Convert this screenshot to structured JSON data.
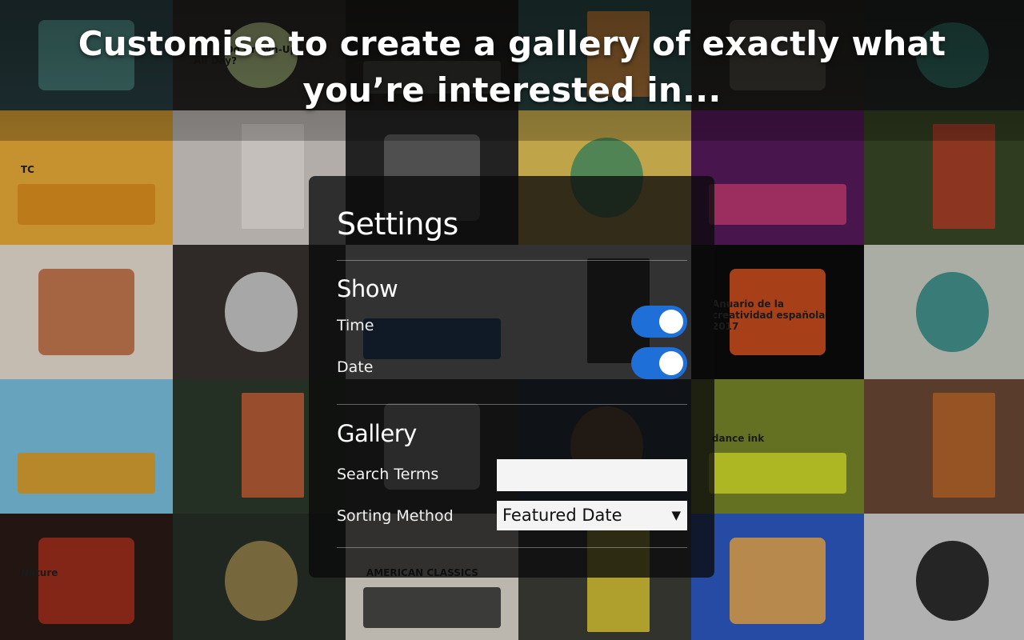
{
  "headline": {
    "line1": "Customise to create a gallery of exactly what",
    "line2": "you’re interested in..."
  },
  "gallery": {
    "tiles": [
      {
        "bg": "#2f4a4d",
        "accent": "#5fa9a2",
        "caption": ""
      },
      {
        "bg": "#2c2a26",
        "accent": "#b8c98a",
        "caption": "What Do Grown-Ups Do All Day?"
      },
      {
        "bg": "#1e1d1b",
        "accent": "#3a3935",
        "caption": ""
      },
      {
        "bg": "#2c4c4a",
        "accent": "#d98a3b",
        "caption": ""
      },
      {
        "bg": "#23221f",
        "accent": "#4a4540",
        "caption": ""
      },
      {
        "bg": "#1f2322",
        "accent": "#2f6d62",
        "caption": ""
      },
      {
        "bg": "#f1b23a",
        "accent": "#e58f1f",
        "caption": "TC"
      },
      {
        "bg": "#d9d4cf",
        "accent": "#f2ede8",
        "caption": ""
      },
      {
        "bg": "#2a2a2a",
        "accent": "#6b6b6b",
        "caption": ""
      },
      {
        "bg": "#e9c85a",
        "accent": "#4b9a6a",
        "caption": ""
      },
      {
        "bg": "#5a1a5e",
        "accent": "#d13f78",
        "caption": ""
      },
      {
        "bg": "#3b4a26",
        "accent": "#c0402a",
        "caption": ""
      },
      {
        "bg": "#efe5d8",
        "accent": "#c46a3a",
        "caption": ""
      },
      {
        "bg": "#3a3330",
        "accent": "#e8e8e8",
        "caption": ""
      },
      {
        "bg": "#e7e7e7",
        "accent": "#0b4f9e",
        "caption": ""
      },
      {
        "bg": "#ece8e3",
        "accent": "#1b1b1b",
        "caption": ""
      },
      {
        "bg": "#0c0c0c",
        "accent": "#ee5a22",
        "caption": "Anuario de la creatividad española 2017"
      },
      {
        "bg": "#cfd3c9",
        "accent": "#2e8c88",
        "caption": ""
      },
      {
        "bg": "#7fc7e8",
        "accent": "#f0a012",
        "caption": ""
      },
      {
        "bg": "#2d3b2b",
        "accent": "#d4653a",
        "caption": ""
      },
      {
        "bg": "#3b3b3b",
        "accent": "#d7d7d7",
        "caption": ""
      },
      {
        "bg": "#2b3a4a",
        "accent": "#9e6a3b",
        "caption": ""
      },
      {
        "bg": "#7b8a2a",
        "accent": "#e3ef2e",
        "caption": "dance ink"
      },
      {
        "bg": "#6d4a36",
        "accent": "#c46b2a",
        "caption": ""
      },
      {
        "bg": "#2a1a16",
        "accent": "#b5321f",
        "caption": "Nature"
      },
      {
        "bg": "#263028",
        "accent": "#a38c51",
        "caption": ""
      },
      {
        "bg": "#e4e0d6",
        "accent": "#2d2d2d",
        "caption": "AMERICAN CLASSICS"
      },
      {
        "bg": "#3d3f37",
        "accent": "#f1dc3a",
        "caption": ""
      },
      {
        "bg": "#2f5cc9",
        "accent": "#ffb54a",
        "caption": ""
      },
      {
        "bg": "#d8d8d8",
        "accent": "#111111",
        "caption": ""
      }
    ]
  },
  "settings": {
    "title": "Settings",
    "show": {
      "heading": "Show",
      "time_label": "Time",
      "time_enabled": true,
      "date_label": "Date",
      "date_enabled": true
    },
    "gallery": {
      "heading": "Gallery",
      "search_label": "Search Terms",
      "search_value": "",
      "sort_label": "Sorting Method",
      "sort_value": "Featured Date"
    },
    "toggle_color": "#1f6fd8"
  }
}
